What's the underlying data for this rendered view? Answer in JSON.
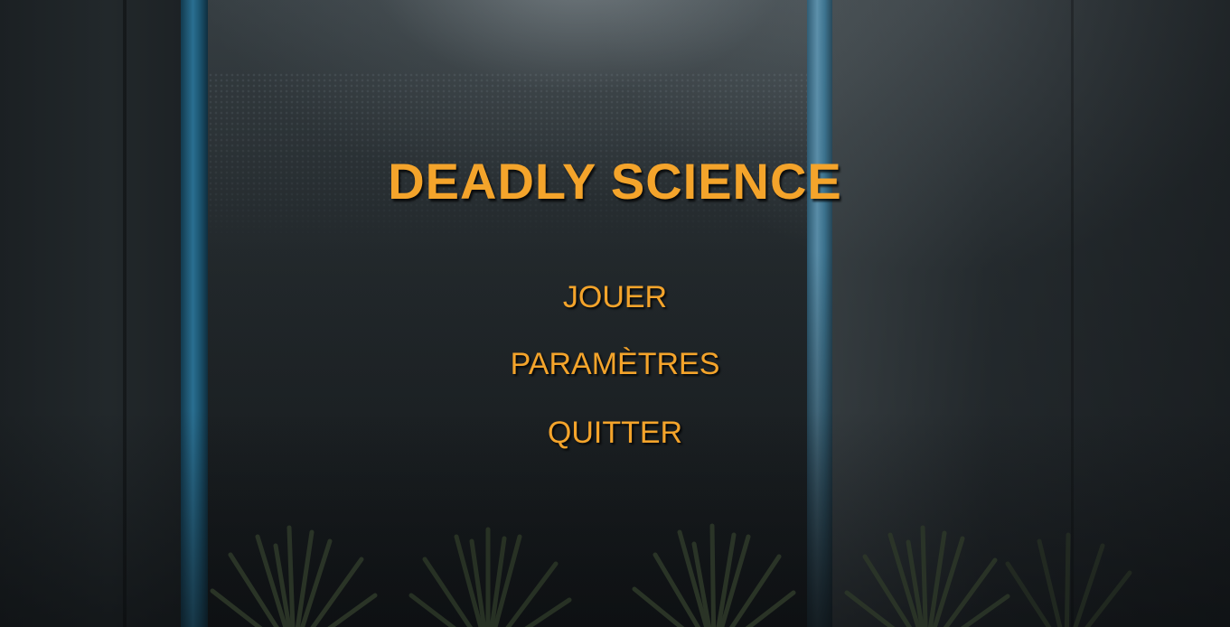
{
  "game": {
    "title": "DEADLY SCIENCE"
  },
  "menu": {
    "items": [
      {
        "id": "play",
        "label": "JOUER"
      },
      {
        "id": "settings",
        "label": "PARAMÈTRES"
      },
      {
        "id": "quit",
        "label": "QUITTER"
      }
    ]
  },
  "colors": {
    "text_accent": "#f4a42b",
    "pillar_blue": "#2a6f91",
    "wall_dark": "#1b2023"
  }
}
